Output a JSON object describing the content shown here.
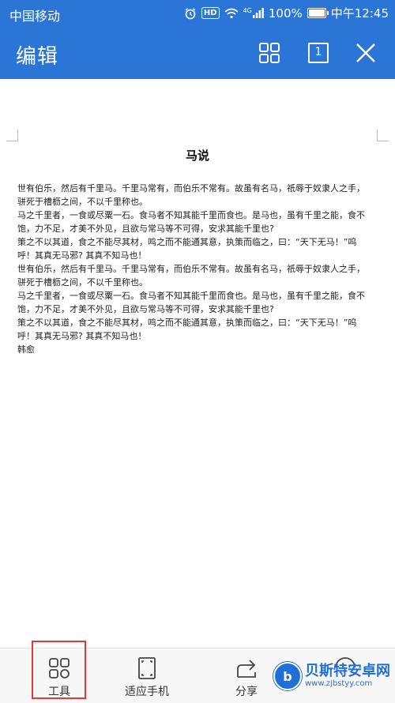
{
  "status_bar": {
    "carrier": "中国移动",
    "hd": "HD",
    "network": "4G",
    "battery": "100%",
    "time": "中午12:45",
    "battery_level": 1.0
  },
  "app_bar": {
    "title": "编辑",
    "page_count": "1",
    "icons": [
      "grid-icon",
      "page-icon",
      "close-icon"
    ]
  },
  "document": {
    "title": "马说",
    "lines": [
      "世有伯乐，然后有千里马。千里马常有，而伯乐不常有。故虽有名马，祇辱于奴隶人之手，",
      "骈死于槽枥之间，不以千里称也。",
      "马之千里者，一食或尽粟一石。食马者不知其能千里而食也。是马也，虽有千里之能，食不",
      "饱，力不足，才美不外见，且欲与常马等不可得，安求其能千里也?",
      "策之不以其道，食之不能尽其材，鸣之而不能通其意，执策而临之，曰：“天下无马！”呜",
      "呼！其真无马邪? 其真不知马也！",
      " 世有伯乐，然后有千里马。千里马常有，而伯乐不常有。故虽有名马，祇辱于奴隶人之手，",
      "骈死于槽枥之间，不以千里称也。",
      "马之千里者，一食或尽粟一石。食马者不知其能千里而食也。是马也，虽有千里之能，食不",
      "饱，力不足，才美不外见，且欲与常马等不可得，安求其能千里也?",
      "策之不以其道，食之不能尽其材，鸣之而不能通其意，执策而临之，曰：“天下无马！”呜",
      "呼！其真无马邪? 其真不知马也！",
      "韩愈"
    ]
  },
  "bottom_bar": {
    "tools": [
      {
        "label": "工具",
        "icon": "tools-grid-icon"
      },
      {
        "label": "适应手机",
        "icon": "fit-phone-icon"
      },
      {
        "label": "分享",
        "icon": "share-icon"
      }
    ]
  },
  "watermark": {
    "name": "贝斯特安卓网",
    "url": "www.zjbstyy.com",
    "logo_letter": "b"
  },
  "colors": {
    "accent": "#2b75d6",
    "highlight": "#e53935",
    "watermark": "#1f6fd6"
  }
}
